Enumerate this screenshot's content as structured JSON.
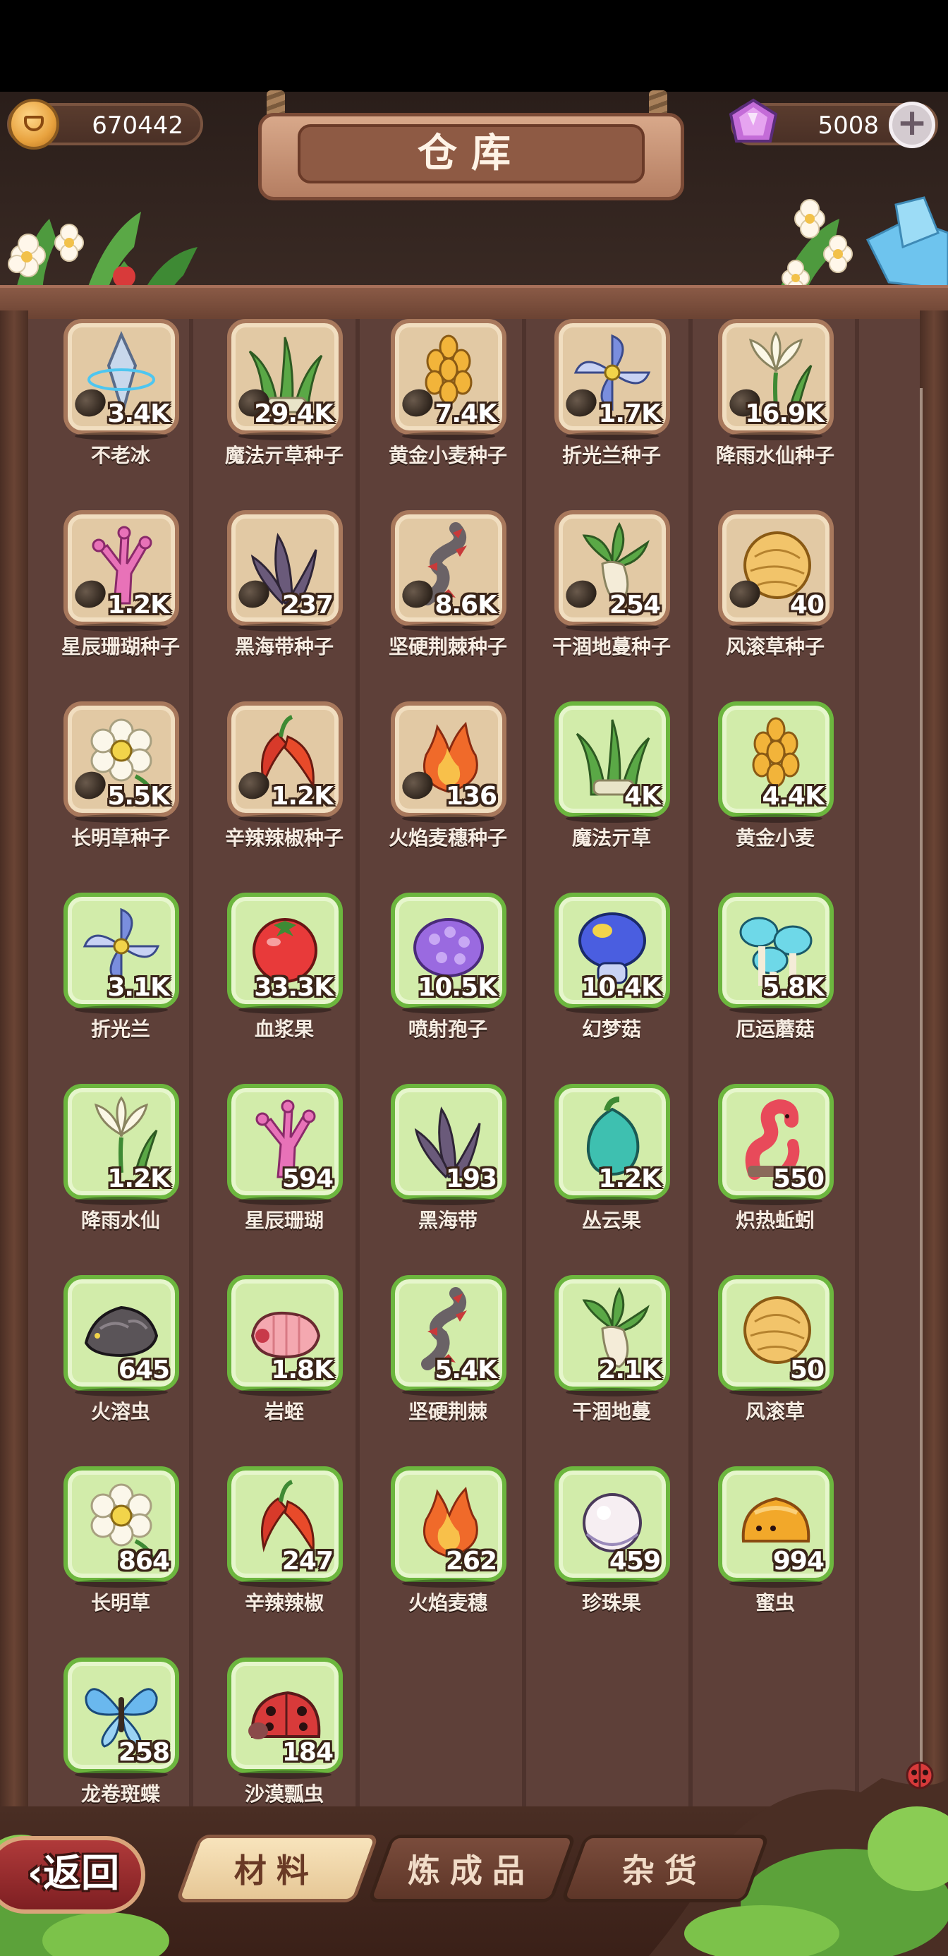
{
  "header": {
    "title": "仓库",
    "coins": "670442",
    "gems": "5008",
    "plus_icon": "plus-icon",
    "coin_icon": "coin-icon",
    "gem_icon": "gem-icon"
  },
  "items": [
    {
      "name": "不老冰",
      "count": "3.4K",
      "type": "seed",
      "icon": "ice-crystal-icon"
    },
    {
      "name": "魔法亓草种子",
      "count": "29.4K",
      "type": "seed",
      "icon": "grass-icon"
    },
    {
      "name": "黄金小麦种子",
      "count": "7.4K",
      "type": "seed",
      "icon": "wheat-icon"
    },
    {
      "name": "折光兰种子",
      "count": "1.7K",
      "type": "seed",
      "icon": "pinwheel-flower-icon"
    },
    {
      "name": "降雨水仙种子",
      "count": "16.9K",
      "type": "seed",
      "icon": "white-lily-icon"
    },
    {
      "name": "星辰珊瑚种子",
      "count": "1.2K",
      "type": "seed",
      "icon": "coral-icon"
    },
    {
      "name": "黑海带种子",
      "count": "237",
      "type": "seed",
      "icon": "kelp-icon"
    },
    {
      "name": "坚硬荆棘种子",
      "count": "8.6K",
      "type": "seed",
      "icon": "thorn-icon"
    },
    {
      "name": "干涸地蔓种子",
      "count": "254",
      "type": "seed",
      "icon": "radish-icon"
    },
    {
      "name": "风滚草种子",
      "count": "40",
      "type": "seed",
      "icon": "tumbleweed-icon"
    },
    {
      "name": "长明草种子",
      "count": "5.5K",
      "type": "seed",
      "icon": "daisy-icon"
    },
    {
      "name": "辛辣辣椒种子",
      "count": "1.2K",
      "type": "seed",
      "icon": "chili-icon"
    },
    {
      "name": "火焰麦穗种子",
      "count": "136",
      "type": "seed",
      "icon": "flame-icon"
    },
    {
      "name": "魔法亓草",
      "count": "4K",
      "type": "mat",
      "icon": "grass-icon"
    },
    {
      "name": "黄金小麦",
      "count": "4.4K",
      "type": "mat",
      "icon": "wheat-icon"
    },
    {
      "name": "折光兰",
      "count": "3.1K",
      "type": "mat",
      "icon": "pinwheel-flower-icon"
    },
    {
      "name": "血浆果",
      "count": "33.3K",
      "type": "mat",
      "icon": "tomato-icon"
    },
    {
      "name": "喷射孢子",
      "count": "10.5K",
      "type": "mat",
      "icon": "spore-icon"
    },
    {
      "name": "幻梦菇",
      "count": "10.4K",
      "type": "mat",
      "icon": "blue-mushroom-icon"
    },
    {
      "name": "厄运蘑菇",
      "count": "5.8K",
      "type": "mat",
      "icon": "cyan-mushroom-icon"
    },
    {
      "name": "降雨水仙",
      "count": "1.2K",
      "type": "mat",
      "icon": "white-lily-icon"
    },
    {
      "name": "星辰珊瑚",
      "count": "594",
      "type": "mat",
      "icon": "coral-icon"
    },
    {
      "name": "黑海带",
      "count": "193",
      "type": "mat",
      "icon": "kelp-icon"
    },
    {
      "name": "丛云果",
      "count": "1.2K",
      "type": "mat",
      "icon": "teal-fruit-icon"
    },
    {
      "name": "炽热蚯蚓",
      "count": "550",
      "type": "mat",
      "icon": "worm-icon"
    },
    {
      "name": "火溶虫",
      "count": "645",
      "type": "mat",
      "icon": "rock-bug-icon"
    },
    {
      "name": "岩蛭",
      "count": "1.8K",
      "type": "mat",
      "icon": "leech-icon"
    },
    {
      "name": "坚硬荆棘",
      "count": "5.4K",
      "type": "mat",
      "icon": "thorn-icon"
    },
    {
      "name": "干涸地蔓",
      "count": "2.1K",
      "type": "mat",
      "icon": "radish-icon"
    },
    {
      "name": "风滚草",
      "count": "50",
      "type": "mat",
      "icon": "tumbleweed-icon"
    },
    {
      "name": "长明草",
      "count": "864",
      "type": "mat",
      "icon": "daisy-icon"
    },
    {
      "name": "辛辣辣椒",
      "count": "247",
      "type": "mat",
      "icon": "chili-icon"
    },
    {
      "name": "火焰麦穗",
      "count": "262",
      "type": "mat",
      "icon": "flame-icon"
    },
    {
      "name": "珍珠果",
      "count": "459",
      "type": "mat",
      "icon": "pearl-icon"
    },
    {
      "name": "蜜虫",
      "count": "994",
      "type": "mat",
      "icon": "honey-bug-icon"
    },
    {
      "name": "龙卷斑蝶",
      "count": "258",
      "type": "mat",
      "icon": "butterfly-icon"
    },
    {
      "name": "沙漠瓢虫",
      "count": "184",
      "type": "mat",
      "icon": "ladybug-icon"
    }
  ],
  "tabs": [
    {
      "label": "材料",
      "active": true
    },
    {
      "label": "炼成品",
      "active": false
    },
    {
      "label": "杂货",
      "active": false
    }
  ],
  "back_label": "返回",
  "colors": {
    "seed_slot": "#e2c9a4",
    "material_slot": "#d2ecaa",
    "material_border": "#6cb63e",
    "wood": "#5e4039"
  }
}
